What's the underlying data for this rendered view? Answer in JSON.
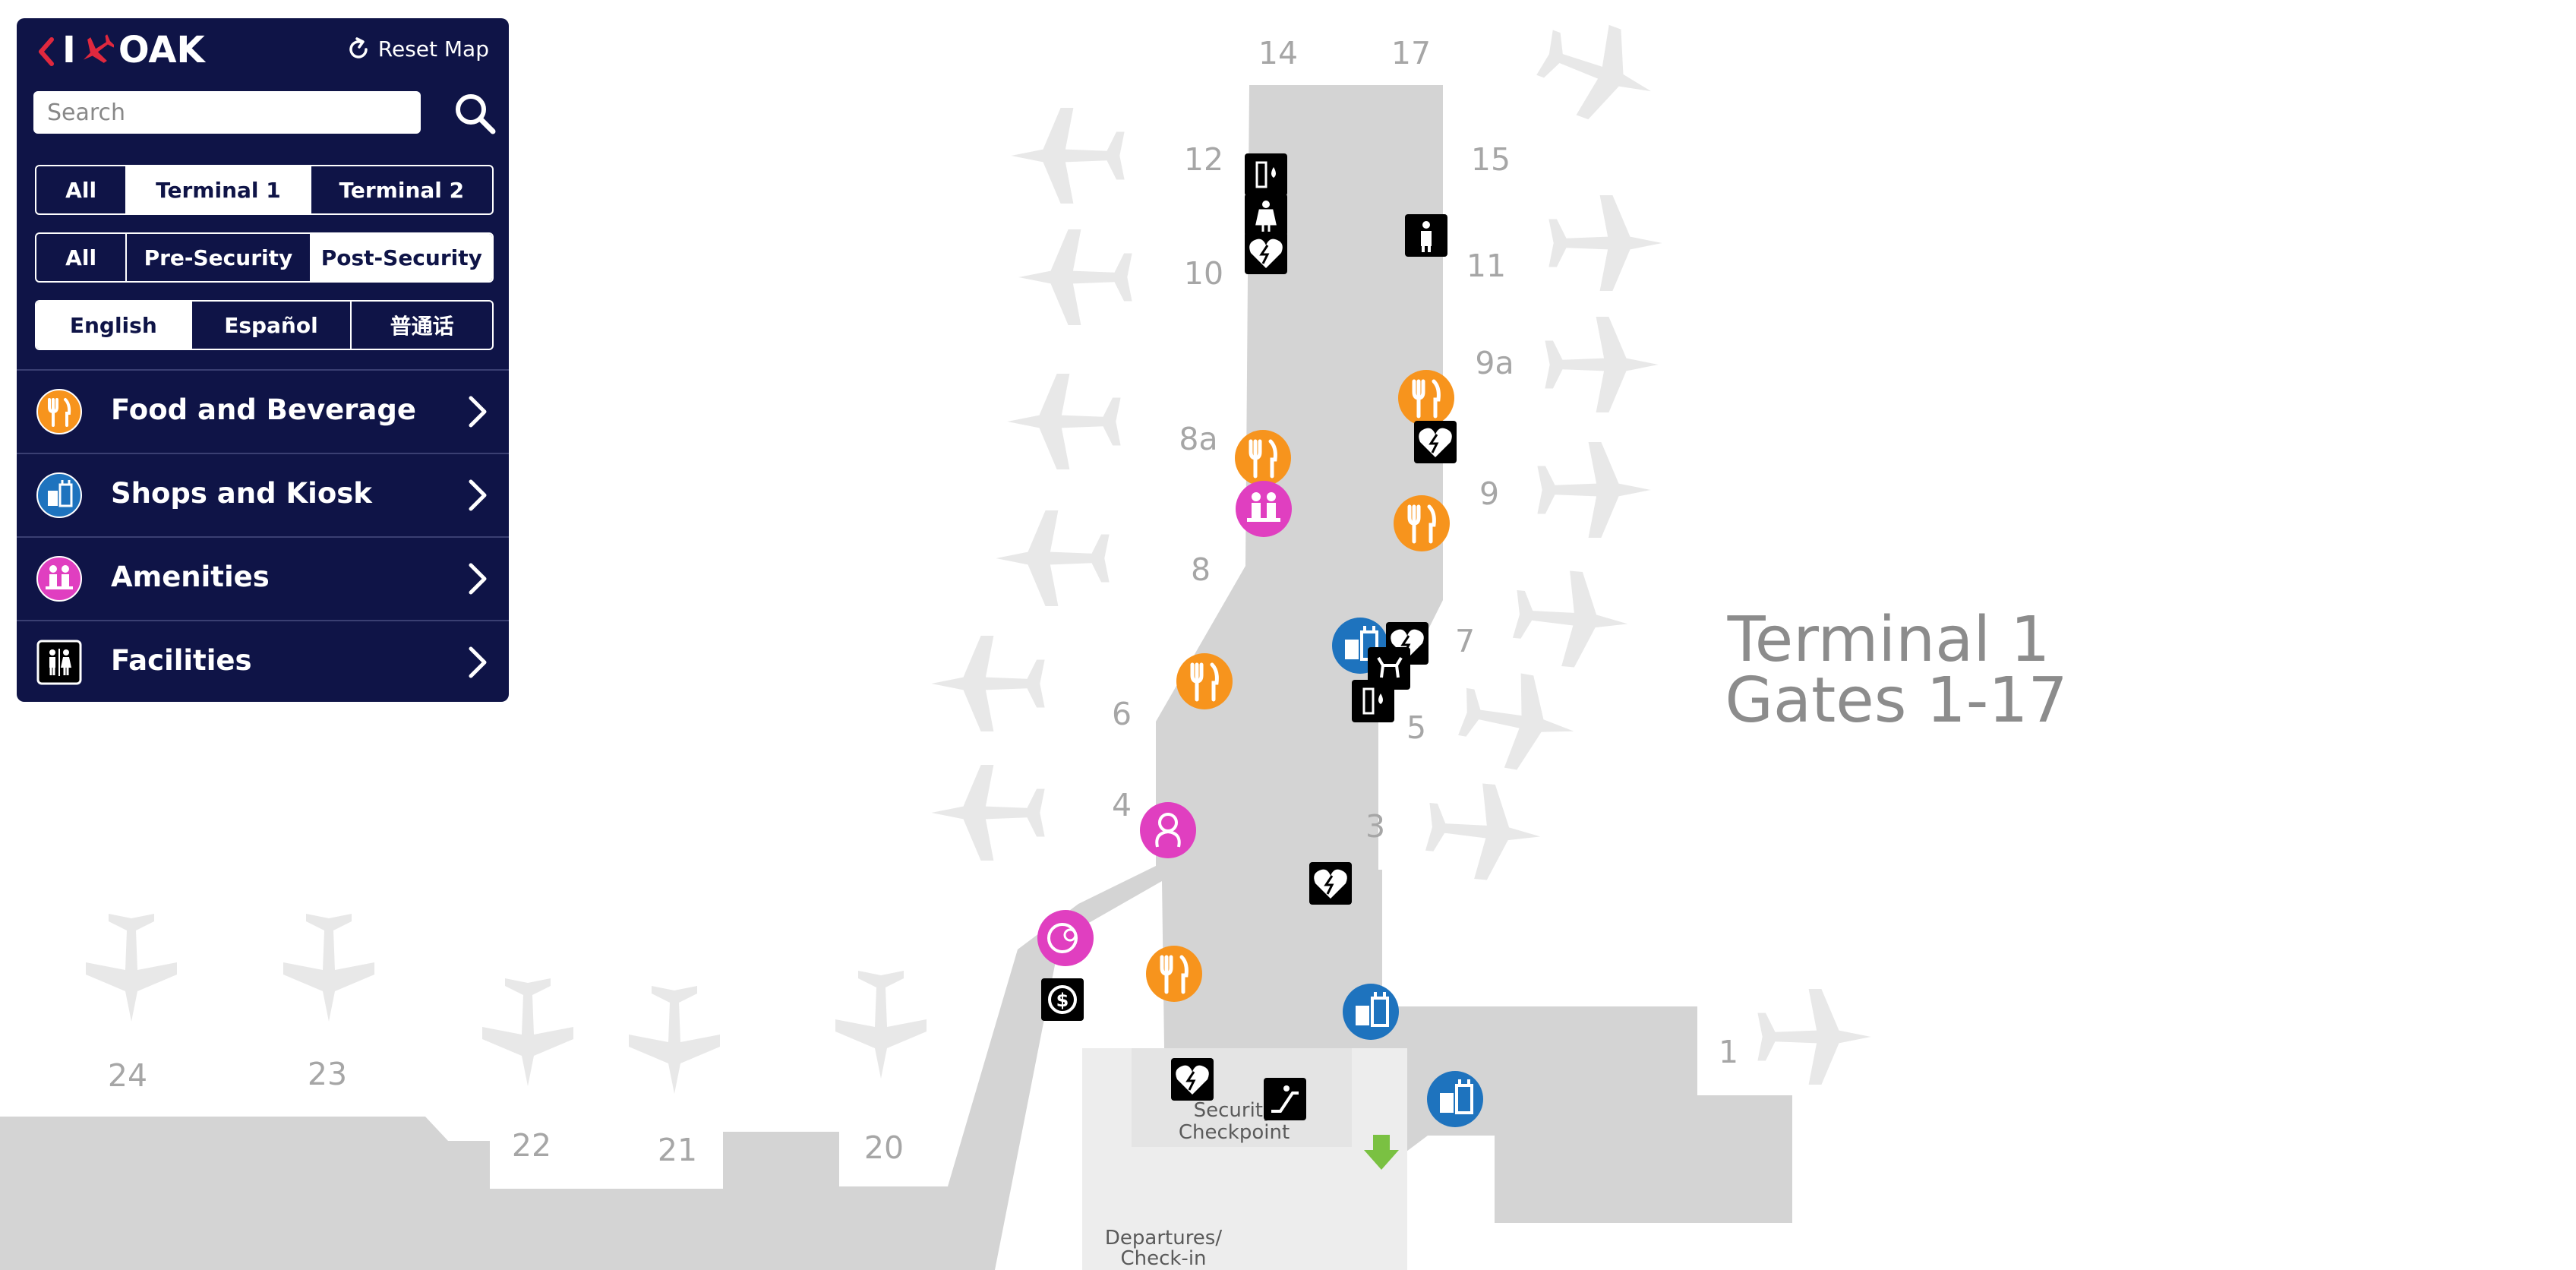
{
  "app": {
    "logo_prefix": "I",
    "logo_text": "OAK",
    "reset_label": "Reset Map"
  },
  "search": {
    "placeholder": "Search"
  },
  "terminal_tabs": [
    {
      "label": "All",
      "active": false
    },
    {
      "label": "Terminal 1",
      "active": true
    },
    {
      "label": "Terminal 2",
      "active": false
    }
  ],
  "security_tabs": [
    {
      "label": "All",
      "active": false
    },
    {
      "label": "Pre-Security",
      "active": false
    },
    {
      "label": "Post-Security",
      "active": true
    }
  ],
  "language_tabs": [
    {
      "label": "English",
      "active": true
    },
    {
      "label": "Español",
      "active": false
    },
    {
      "label": "普通话",
      "active": false
    }
  ],
  "categories": [
    {
      "label": "Food and Beverage",
      "icon": "fork-knife-icon",
      "color": "#f7941d"
    },
    {
      "label": "Shops and Kiosk",
      "icon": "shopping-bag-icon",
      "color": "#1e73be"
    },
    {
      "label": "Amenities",
      "icon": "family-icon",
      "color": "#e03fc0"
    },
    {
      "label": "Facilities",
      "icon": "restroom-icon",
      "color": "#000000"
    }
  ],
  "map": {
    "terminal_title_line1": "Terminal 1",
    "terminal_title_line2": "Gates 1-17",
    "security_label_line1": "Security",
    "security_label_line2": "Checkpoint",
    "departures_label_line1": "Departures/",
    "departures_label_line2": "Check-in",
    "gates": [
      "14",
      "17",
      "12",
      "15",
      "10",
      "11",
      "9a",
      "8a",
      "9",
      "8",
      "7",
      "6",
      "5",
      "4",
      "3",
      "1",
      "24",
      "23",
      "22",
      "21",
      "20"
    ]
  },
  "colors": {
    "panel_bg": "#0f1447",
    "food": "#f7941d",
    "shops": "#1e73be",
    "amenities": "#e03fc0",
    "facilities": "#000000",
    "floor": "#d4d4d4",
    "arrow": "#7ac142"
  }
}
